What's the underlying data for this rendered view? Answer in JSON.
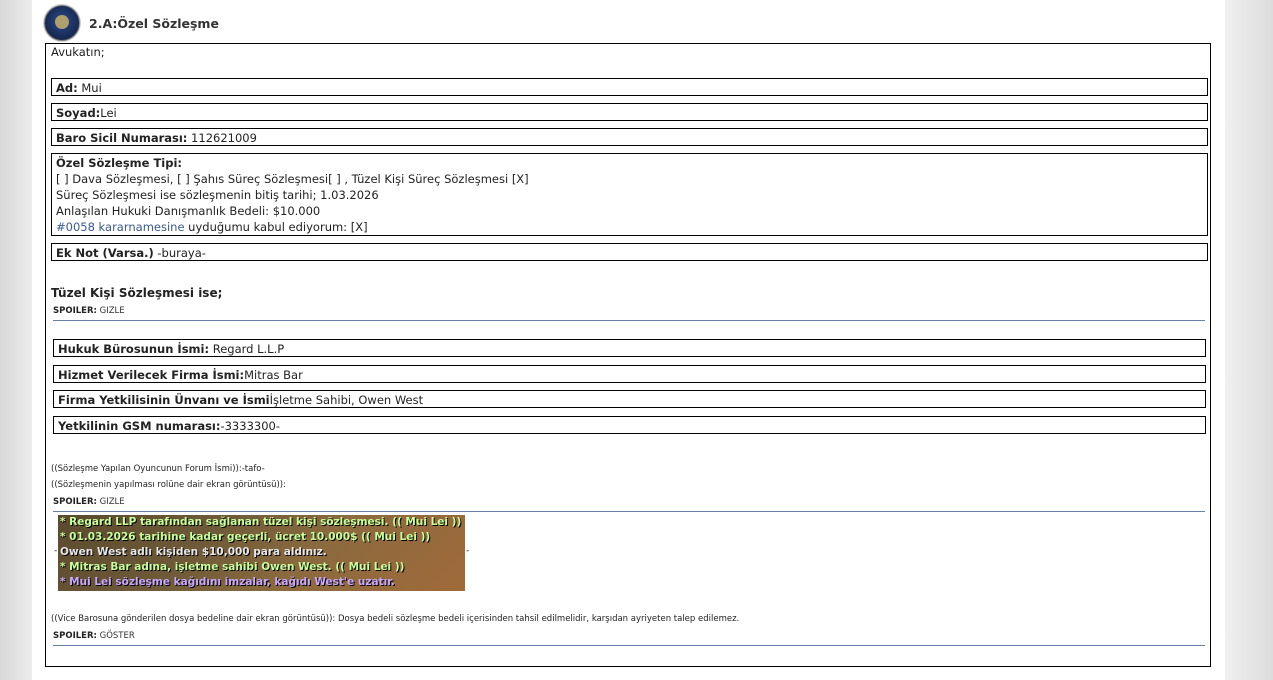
{
  "header": {
    "title": "2.A:Özel Sözleşme"
  },
  "intro": "Avukatın;",
  "fields": {
    "ad": {
      "label": "Ad:",
      "value": " Mui"
    },
    "soyad": {
      "label": "Soyad:",
      "value": "Lei"
    },
    "baro": {
      "label": "Baro Sicil Numarası:",
      "value": " 112621009"
    },
    "ozel": {
      "label": "Özel Sözleşme Tipi:",
      "line1": "[ ] Dava Sözleşmesi, [ ] Şahıs Süreç Sözleşmesi[ ] , Tüzel Kişi Süreç Sözleşmesi [X]",
      "line2": "Süreç Sözleşmesi ise sözleşmenin bitiş tarihi; 1.03.2026",
      "line3": "Anlaşılan Hukuki Danışmanlık Bedeli: $10.000",
      "line4_link": "#0058 kararnamesine",
      "line4_rest": " uyduğumu kabul ediyorum: [X]"
    },
    "eknot": {
      "label": "Ek Not (Varsa.)",
      "value": " -buraya-"
    }
  },
  "tuzel": {
    "heading": "Tüzel Kişi Sözleşmesi ise;",
    "spoiler_label": "SPOILER:",
    "spoiler_button": "GIZLE",
    "fields": {
      "buro": {
        "label": "Hukuk Bürosunun İsmi:",
        "value": " Regard L.L.P"
      },
      "firma": {
        "label": "Hizmet Verilecek Firma İsmi:",
        "value": "Mitras Bar"
      },
      "yetkili": {
        "label": "Firma Yetkilisinin Ünvanı ve İsmi",
        "value": "İşletme Sahibi, Owen West"
      },
      "gsm": {
        "label": "Yetkilinin GSM numarası:",
        "value": "-3333300-"
      }
    }
  },
  "forum": {
    "line1": "((Sözleşme Yapılan Oyuncunun Forum İsmi)):-tafo-",
    "line2": "((Sözleşmenin yapılması rolüne dair ekran görüntüsü)):",
    "spoiler_label": "SPOILER:",
    "spoiler_button": "GIZLE"
  },
  "screenshot": {
    "lines": [
      "* Regard LLP tarafından sağlanan tüzel kişi sözleşmesi.  (( Mui Lei ))",
      "* 01.03.2026 tarihine kadar geçerli, ücret 10.000$ (( Mui Lei ))",
      "Owen West adlı kişiden $10,000 para aldınız.",
      "* Mitras Bar adına, işletme sahibi Owen West. (( Mui Lei ))",
      "* Mui Lei sözleşme kağıdını imzalar, kağıdı West'e uzatır."
    ],
    "colors": [
      "#c9ff9a",
      "#c9ff9a",
      "#e8e8e8",
      "#c9ff9a",
      "#c9a8ff"
    ]
  },
  "vice": {
    "text": "((Vice Barosuna gönderilen dosya bedeline dair ekran görüntüsü)): Dosya bedeli sözleşme bedeli içerisinden tahsil edilmelidir, karşıdan ayriyeten talep edilemez.",
    "spoiler_label": "SPOILER:",
    "spoiler_button": "GÖSTER"
  }
}
